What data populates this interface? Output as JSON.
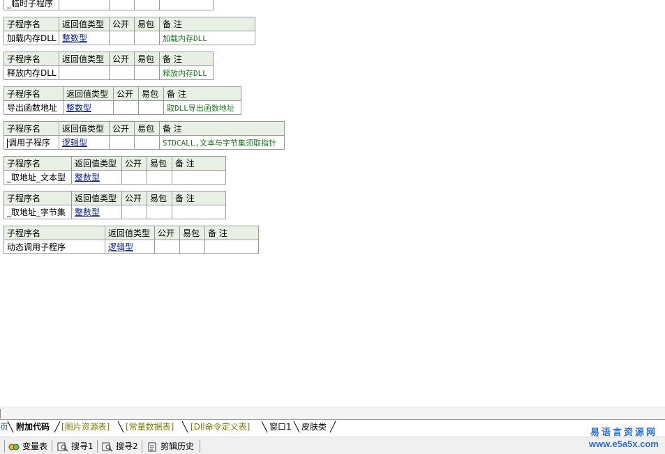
{
  "headers": {
    "name": "子程序名",
    "ret": "返回值类型",
    "public": "公开",
    "pack": "易包",
    "note": "备 注"
  },
  "top_partial": {
    "name": "_临时子程序"
  },
  "subs": [
    {
      "name": "加载内存DLL",
      "ret": "整数型",
      "note": "加载内存DLL"
    },
    {
      "name": "释放内存DLL",
      "ret": "",
      "note": "释放内存DLL"
    },
    {
      "name": "导出函数地址",
      "ret": "整数型",
      "note": "取DLL导出函数地址"
    },
    {
      "name": "调用子程序",
      "ret": "逻辑型",
      "note": "STDCALL,文本与字节集须取指针"
    },
    {
      "name": "_取地址_文本型",
      "ret": "整数型",
      "note": ""
    },
    {
      "name": "_取地址_字节集",
      "ret": "整数型",
      "note": ""
    },
    {
      "name": "动态调用子程序",
      "ret": "逻辑型",
      "note": ""
    }
  ],
  "tabs": [
    {
      "label": "页"
    },
    {
      "label": "附加代码"
    },
    {
      "label": "[图片资源表]"
    },
    {
      "label": "[常量数据表]"
    },
    {
      "label": "[Dll命令定义表]"
    },
    {
      "label": "窗口1"
    },
    {
      "label": "皮肤类"
    }
  ],
  "bottom": {
    "variables": "变量表",
    "search1": "搜寻1",
    "search2": "搜寻2",
    "clip_history": "剪辑历史"
  },
  "logo": {
    "cn": "易语言资源网",
    "url": "www.e5a5x.com"
  }
}
